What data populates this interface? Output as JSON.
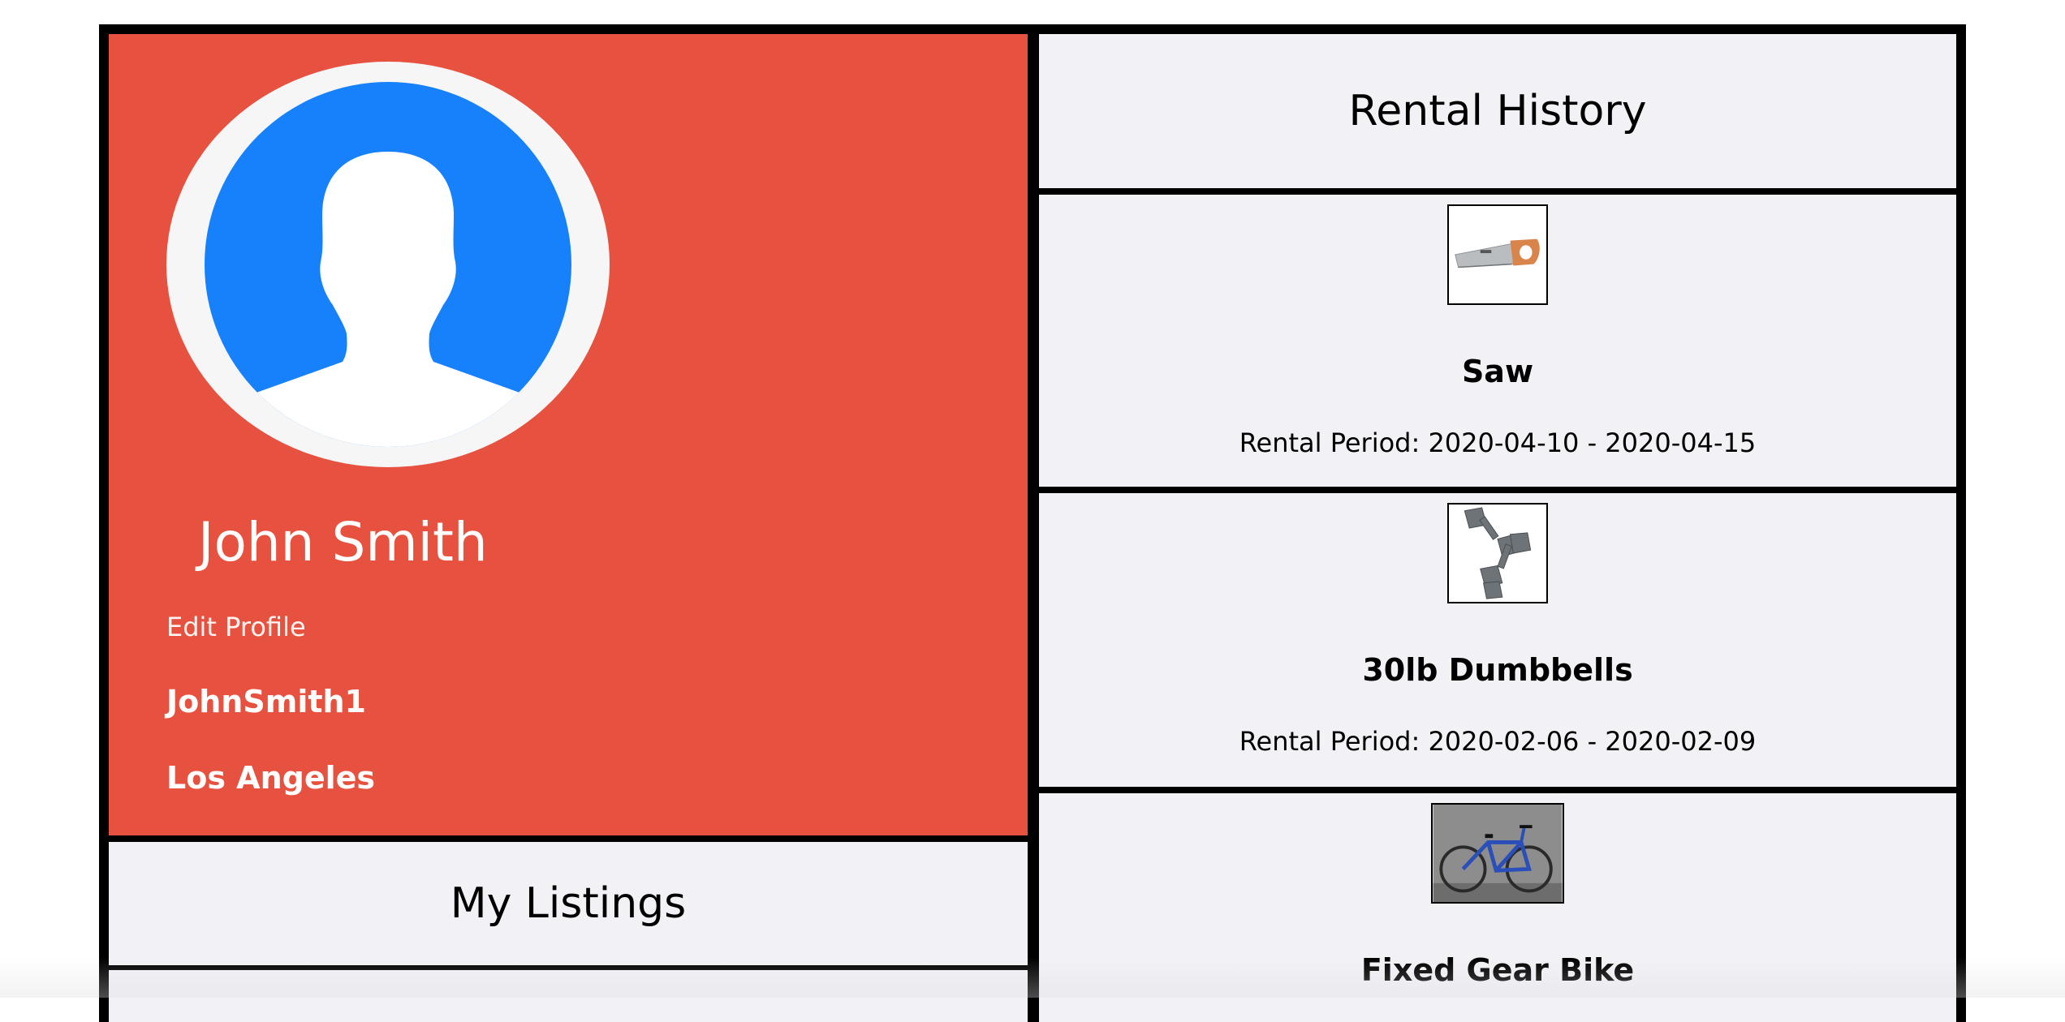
{
  "profile": {
    "name": "John Smith",
    "edit_label": "Edit Profile",
    "username": "JohnSmith1",
    "city": "Los Angeles",
    "avatar_icon": "user-silhouette-icon"
  },
  "listings": {
    "title": "My Listings"
  },
  "rental_history": {
    "title": "Rental History",
    "items": [
      {
        "name": "Saw",
        "period": "Rental Period: 2020-04-10 - 2020-04-15",
        "image": "saw-image"
      },
      {
        "name": "30lb Dumbbells",
        "period": "Rental Period: 2020-02-06 - 2020-02-09",
        "image": "dumbbells-image"
      },
      {
        "name": "Fixed Gear Bike",
        "period": "",
        "image": "bike-image"
      }
    ]
  },
  "colors": {
    "profile_bg": "#e75240",
    "panel_bg": "#f2f2f6",
    "avatar_blue": "#1781fb",
    "border": "#000000"
  }
}
